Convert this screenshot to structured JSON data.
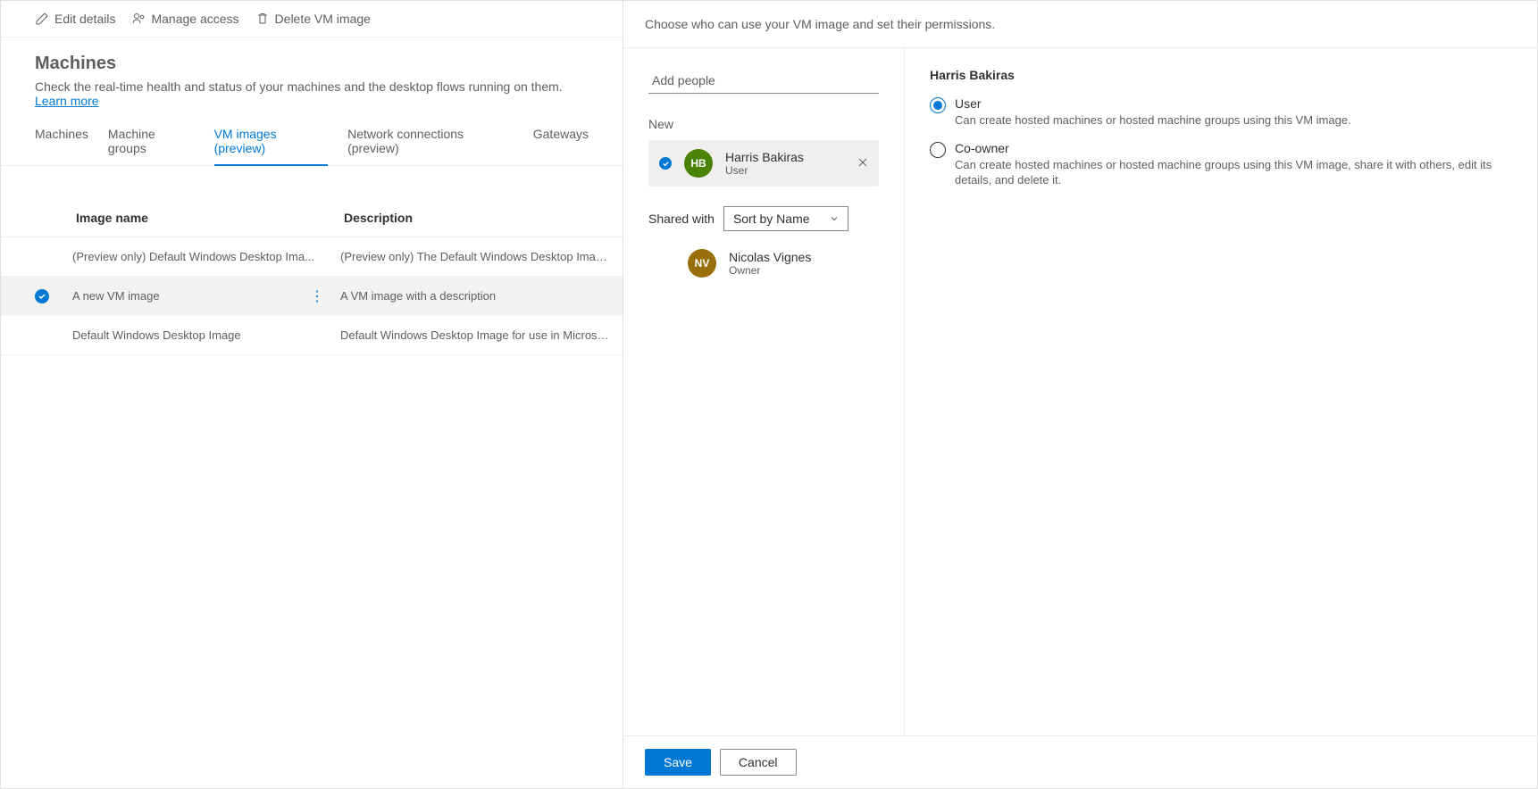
{
  "toolbar": {
    "edit": "Edit details",
    "manage": "Manage access",
    "delete": "Delete VM image"
  },
  "header": {
    "title": "Machines",
    "desc": "Check the real-time health and status of your machines and the desktop flows running on them. ",
    "learn": "Learn more"
  },
  "tabs": {
    "machines": "Machines",
    "groups": "Machine groups",
    "vm": "VM images (preview)",
    "network": "Network connections (preview)",
    "gateways": "Gateways"
  },
  "table": {
    "col_name": "Image name",
    "col_desc": "Description",
    "rows": [
      {
        "name": "(Preview only) Default Windows Desktop Ima...",
        "desc": "(Preview only) The Default Windows Desktop Image for use i...",
        "selected": false
      },
      {
        "name": "A new VM image",
        "desc": "A VM image with a description",
        "selected": true
      },
      {
        "name": "Default Windows Desktop Image",
        "desc": "Default Windows Desktop Image for use in Microsoft Deskto...",
        "selected": false
      }
    ]
  },
  "panel": {
    "intro": "Choose who can use your VM image and set their permissions.",
    "add_placeholder": "Add people",
    "new_label": "New",
    "new_person": {
      "name": "Harris Bakiras",
      "role": "User",
      "initials": "HB",
      "color": "#498205"
    },
    "shared_label": "Shared with",
    "sort": "Sort by Name",
    "owner": {
      "name": "Nicolas Vignes",
      "role": "Owner",
      "initials": "NV",
      "color": "#986f0b"
    },
    "perm": {
      "title": "Harris Bakiras",
      "options": [
        {
          "label": "User",
          "desc": "Can create hosted machines or hosted machine groups using this VM image.",
          "checked": true
        },
        {
          "label": "Co-owner",
          "desc": "Can create hosted machines or hosted machine groups using this VM image, share it with others, edit its details, and delete it.",
          "checked": false
        }
      ]
    },
    "save": "Save",
    "cancel": "Cancel"
  }
}
